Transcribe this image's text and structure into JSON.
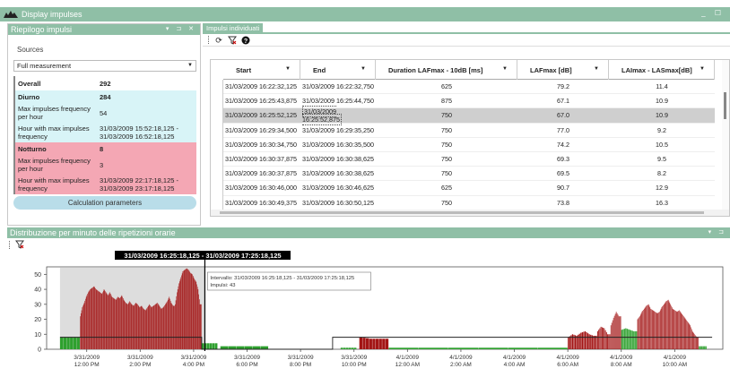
{
  "window": {
    "title": "Display impulses",
    "controls": "_ ☐"
  },
  "left_panel": {
    "title": "Riepilogo impulsi",
    "controls": "▾ ⊐ ✕",
    "sources_label": "Sources",
    "source_selected": "Full measurement",
    "overall_label": "Overall",
    "overall_value": "292",
    "diurno_label": "Diurno",
    "diurno_value": "284",
    "diurno_freq_label": "Max impulses frequency per hour",
    "diurno_freq_value": "54",
    "diurno_hour_label": "Hour with max impulses frequency",
    "diurno_hour_value": "31/03/2009 15:52:18,125 - 31/03/2009 16:52:18,125",
    "notturno_label": "Notturno",
    "notturno_value": "8",
    "notturno_freq_label": "Max impulses frequency per hour",
    "notturno_freq_value": "3",
    "notturno_hour_label": "Hour with max impulses frequency",
    "notturno_hour_value": "31/03/2009 22:17:18,125 - 31/03/2009 23:17:18,125",
    "calc_button": "Calculation parameters"
  },
  "right_panel": {
    "tab": "Impulsi individuati",
    "columns": [
      "Start",
      "End",
      "Duration LAFmax - 10dB [ms]",
      "LAFmax [dB]",
      "LAImax - LASmax[dB]"
    ],
    "rows": [
      [
        "31/03/2009 16:22:32,125",
        "31/03/2009 16:22:32,750",
        "625",
        "79.2",
        "11.4"
      ],
      [
        "31/03/2009 16:25:43,875",
        "31/03/2009 16:25:44,750",
        "875",
        "67.1",
        "10.9"
      ],
      [
        "31/03/2009 16:25:52,125",
        "31/03/2009 16:25:52,875",
        "750",
        "67.0",
        "10.9"
      ],
      [
        "31/03/2009 16:29:34,500",
        "31/03/2009 16:29:35,250",
        "750",
        "77.0",
        "9.2"
      ],
      [
        "31/03/2009 16:30:34,750",
        "31/03/2009 16:30:35,500",
        "750",
        "74.2",
        "10.5"
      ],
      [
        "31/03/2009 16:30:37,875",
        "31/03/2009 16:30:38,625",
        "750",
        "69.3",
        "9.5"
      ],
      [
        "31/03/2009 16:30:37,875",
        "31/03/2009 16:30:38,625",
        "750",
        "69.5",
        "8.2"
      ],
      [
        "31/03/2009 16:30:46,000",
        "31/03/2009 16:30:46,625",
        "625",
        "90.7",
        "12.9"
      ],
      [
        "31/03/2009 16:30:49,375",
        "31/03/2009 16:30:50,125",
        "750",
        "73.8",
        "16.3"
      ]
    ],
    "selected_row": 2
  },
  "bottom_panel": {
    "title": "Distribuzione per minuto delle ripetizioni orarie",
    "controls": "▾ ⊐"
  },
  "chart_data": {
    "type": "bar",
    "range_label": "31/03/2009 16:25:18,125 - 31/03/2009 17:25:18,125",
    "tooltip_line1": "Intervallo: 31/03/2009 16:25:18,125 - 31/03/2009 17:25:18,125",
    "tooltip_line2": "Impulsi: 43",
    "ylim": [
      0,
      55
    ],
    "yticks": [
      0,
      10,
      20,
      30,
      40,
      50
    ],
    "xticks": [
      {
        "d": "3/31/2009",
        "t": "12:00 PM"
      },
      {
        "d": "3/31/2009",
        "t": "2:00 PM"
      },
      {
        "d": "3/31/2009",
        "t": "4:00 PM"
      },
      {
        "d": "3/31/2009",
        "t": "6:00 PM"
      },
      {
        "d": "3/31/2009",
        "t": "8:00 PM"
      },
      {
        "d": "3/31/2009",
        "t": "10:00 PM"
      },
      {
        "d": "4/1/2009",
        "t": "12:00 AM"
      },
      {
        "d": "4/1/2009",
        "t": "2:00 AM"
      },
      {
        "d": "4/1/2009",
        "t": "4:00 AM"
      },
      {
        "d": "4/1/2009",
        "t": "6:00 AM"
      },
      {
        "d": "4/1/2009",
        "t": "8:00 AM"
      },
      {
        "d": "4/1/2009",
        "t": "10:00 AM"
      }
    ],
    "colors": {
      "day": "#a31515",
      "night": "#2ea02e",
      "highlight": "#dddddd",
      "line": "#222222"
    },
    "segments": [
      {
        "x0": 11.0,
        "x1": 11.75,
        "values": [
          8,
          8
        ],
        "color": "night"
      },
      {
        "x0": 11.75,
        "x1": 15.3,
        "values": [
          22,
          28,
          31,
          35,
          38,
          40,
          41,
          42,
          40,
          39,
          38,
          37,
          40,
          38,
          36,
          38,
          35,
          34,
          33,
          35,
          34,
          36,
          33,
          31,
          30,
          32,
          30,
          29,
          31,
          30,
          28,
          29,
          27,
          26,
          28,
          30,
          28,
          29,
          30,
          31,
          29,
          27,
          28,
          30,
          32,
          35,
          31,
          29
        ],
        "color": "day"
      },
      {
        "x0": 15.3,
        "x1": 16.3,
        "values": [
          30,
          38,
          44,
          48,
          52,
          53,
          54,
          53,
          51,
          50,
          47,
          45,
          40,
          30
        ],
        "color": "day"
      },
      {
        "x0": 16.3,
        "x1": 16.9,
        "values": [
          4,
          4
        ],
        "color": "night"
      },
      {
        "x0": 17.0,
        "x1": 18.8,
        "values": [
          2,
          2
        ],
        "color": "night"
      },
      {
        "x0": 21.5,
        "x1": 22.1,
        "values": [
          1,
          1
        ],
        "color": "night"
      },
      {
        "x0": 22.2,
        "x1": 23.3,
        "values": [
          8,
          7,
          7
        ],
        "color": "day"
      },
      {
        "x0": 23.3,
        "x1": 30.0,
        "values": [
          1,
          1
        ],
        "color": "night"
      },
      {
        "x0": 30.0,
        "x1": 31.1,
        "values": [
          8,
          10,
          9,
          11,
          12,
          10,
          9
        ],
        "color": "day"
      },
      {
        "x0": 31.1,
        "x1": 31.6,
        "values": [
          12,
          15,
          14,
          10
        ],
        "color": "day"
      },
      {
        "x0": 31.6,
        "x1": 32.0,
        "values": [
          16,
          21,
          25,
          22
        ],
        "color": "day"
      },
      {
        "x0": 32.0,
        "x1": 32.6,
        "values": [
          13,
          14,
          13,
          12
        ],
        "color": "night"
      },
      {
        "x0": 32.6,
        "x1": 34.9,
        "values": [
          20,
          22,
          25,
          27,
          29,
          30,
          27,
          26,
          25,
          24,
          25,
          28,
          30,
          32,
          33,
          30,
          27,
          26,
          25,
          26,
          24,
          22,
          20,
          18,
          16,
          12,
          10,
          8
        ],
        "color": "day"
      },
      {
        "x0": 34.9,
        "x1": 35.2,
        "values": [
          2,
          2
        ],
        "color": "night"
      }
    ],
    "step_line": [
      [
        11.0,
        8
      ],
      [
        16.3,
        8
      ],
      [
        16.3,
        0
      ],
      [
        21.2,
        0
      ],
      [
        21.2,
        8
      ],
      [
        35.4,
        8
      ]
    ],
    "highlight": {
      "x0": 11.0,
      "x1": 16.42
    },
    "cursor_x": 16.42,
    "xlim": [
      10.5,
      35.8
    ]
  }
}
